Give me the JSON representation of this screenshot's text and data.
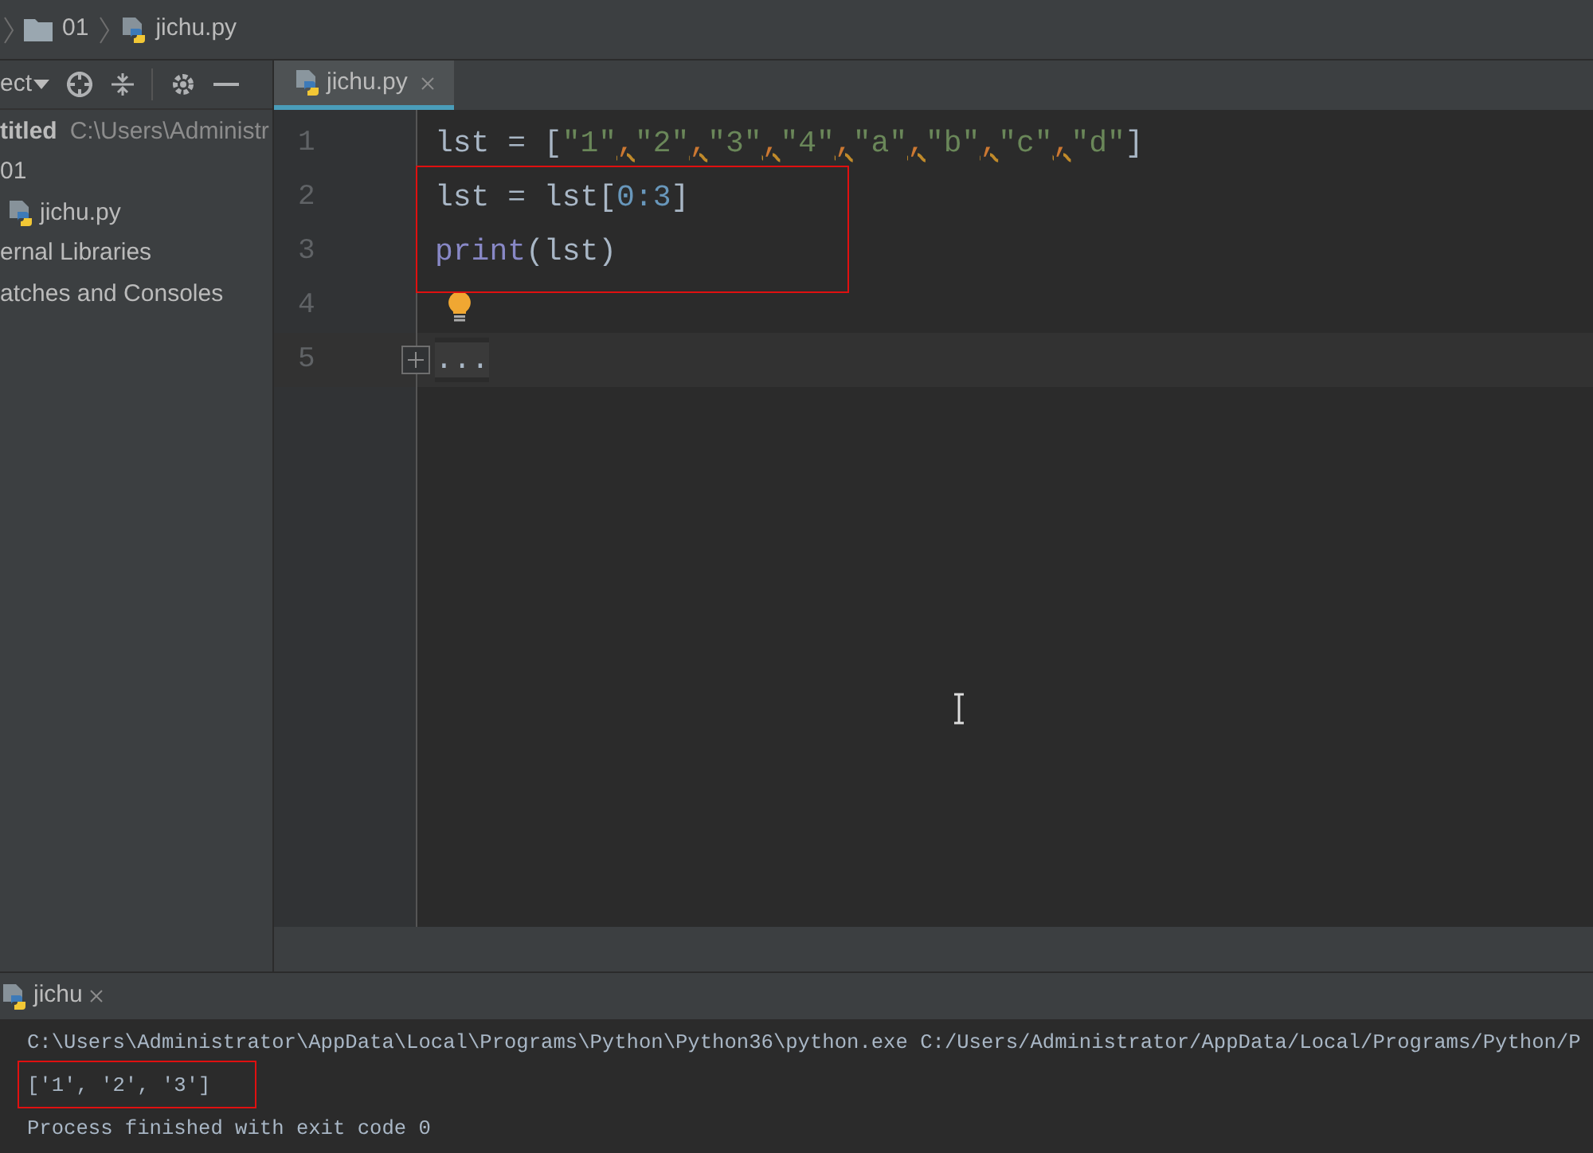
{
  "breadcrumb": [
    {
      "text": "01",
      "kind": "folder"
    },
    {
      "text": "jichu.py",
      "kind": "python"
    }
  ],
  "project_toolbar": {
    "label": "ect"
  },
  "tree": [
    {
      "label": "titled",
      "path": "C:\\Users\\Administr",
      "children": [
        {
          "label": "01",
          "children": [
            {
              "label": "jichu.py",
              "kind": "python"
            }
          ]
        }
      ]
    },
    {
      "label": "ernal Libraries"
    },
    {
      "label": "atches and Consoles"
    }
  ],
  "editor_tabs": [
    {
      "label": "jichu.py",
      "selected": true
    }
  ],
  "code_lines": [
    {
      "number": "1",
      "tokens": [
        {
          "text": "lst = [",
          "kind": "plain"
        },
        {
          "text": "\"1\"",
          "kind": "string"
        },
        {
          "text": ",",
          "kind": "warning"
        },
        {
          "text": "\"2\"",
          "kind": "string"
        },
        {
          "text": ",",
          "kind": "warning"
        },
        {
          "text": "\"3\"",
          "kind": "string"
        },
        {
          "text": ",",
          "kind": "warning"
        },
        {
          "text": "\"4\"",
          "kind": "string"
        },
        {
          "text": ",",
          "kind": "warning"
        },
        {
          "text": "\"a\"",
          "kind": "string"
        },
        {
          "text": ",",
          "kind": "warning"
        },
        {
          "text": "\"b\"",
          "kind": "string"
        },
        {
          "text": ",",
          "kind": "warning"
        },
        {
          "text": "\"c\"",
          "kind": "string"
        },
        {
          "text": ",",
          "kind": "warning"
        },
        {
          "text": "\"d\"",
          "kind": "string"
        },
        {
          "text": "]",
          "kind": "plain"
        }
      ]
    },
    {
      "number": "2",
      "tokens": [
        {
          "text": "lst = lst[",
          "kind": "plain"
        },
        {
          "text": "0:3",
          "kind": "number"
        },
        {
          "text": "]",
          "kind": "plain"
        }
      ]
    },
    {
      "number": "3",
      "tokens": [
        {
          "text": "print",
          "kind": "builtin"
        },
        {
          "text": "(lst)",
          "kind": "plain"
        }
      ]
    },
    {
      "number": "4",
      "bulb": true
    },
    {
      "number": "5",
      "current": true,
      "folded": true,
      "tokens": [
        {
          "text": "...",
          "kind": "fold"
        }
      ]
    }
  ],
  "run_tab": {
    "label": "jichu"
  },
  "console_lines": [
    {
      "text": "C:\\Users\\Administrator\\AppData\\Local\\Programs\\Python\\Python36\\python.exe C:/Users/Administrator/AppData/Local/Programs/Python/P"
    },
    {
      "text": "['1', '2', '3']"
    },
    {
      "text": "Process finished with exit code 0"
    }
  ]
}
